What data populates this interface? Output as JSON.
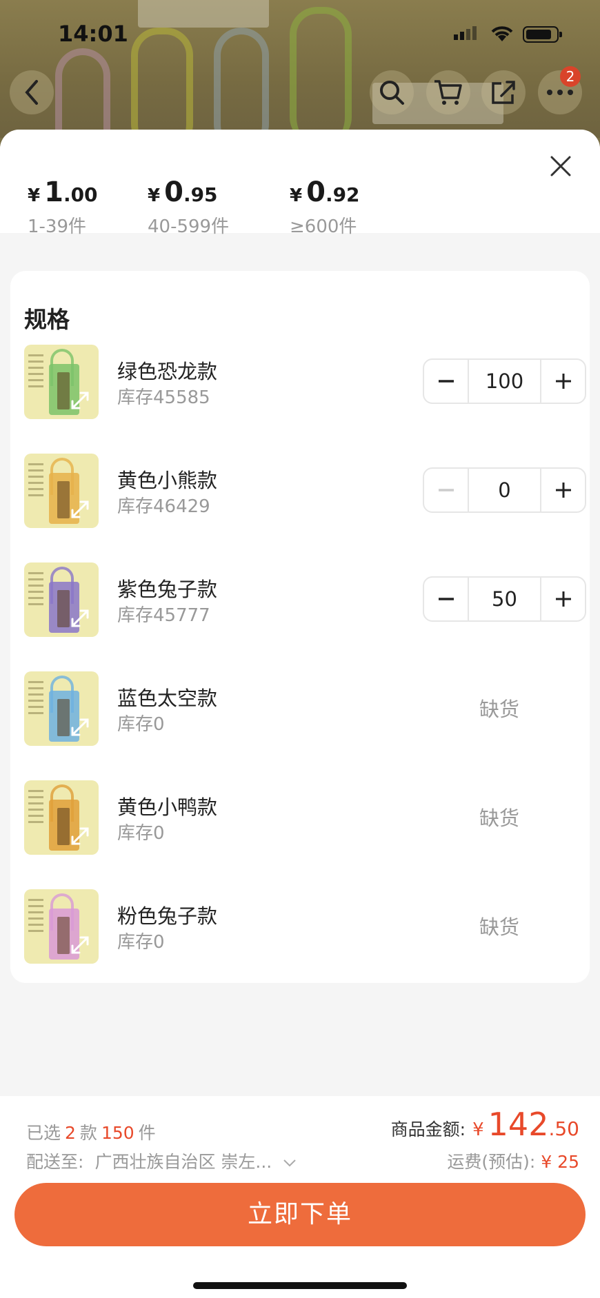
{
  "status": {
    "time": "14:01"
  },
  "nav": {
    "cart_badge": "2"
  },
  "price_tiers": [
    {
      "currency": "¥",
      "int": "1",
      "dec": ".00",
      "range": "1-39件"
    },
    {
      "currency": "¥",
      "int": "0",
      "dec": ".95",
      "range": "40-599件"
    },
    {
      "currency": "¥",
      "int": "0",
      "dec": ".92",
      "range": "≥600件"
    }
  ],
  "spec": {
    "title": "规格",
    "items": [
      {
        "name": "绿色恐龙款",
        "stock": "库存45585",
        "qty": "100",
        "color": "#7cc36a"
      },
      {
        "name": "黄色小熊款",
        "stock": "库存46429",
        "qty": "0",
        "color": "#e6b24a"
      },
      {
        "name": "紫色兔子款",
        "stock": "库存45777",
        "qty": "50",
        "color": "#8a77c9"
      },
      {
        "name": "蓝色太空款",
        "stock": "库存0",
        "status": "缺货",
        "color": "#6fb2e0"
      },
      {
        "name": "黄色小鸭款",
        "stock": "库存0",
        "status": "缺货",
        "color": "#e0a03a"
      },
      {
        "name": "粉色兔子款",
        "stock": "库存0",
        "status": "缺货",
        "color": "#d99ad6"
      }
    ]
  },
  "summary": {
    "selected_prefix": "已选",
    "selected_styles": "2",
    "styles_unit": "款",
    "selected_pieces": "150",
    "pieces_unit": "件",
    "ship_label": "配送至:",
    "ship_dest": "广西壮族自治区 崇左...",
    "amount_label": "商品金额:",
    "amount_currency": "¥",
    "amount_int": "142",
    "amount_dec": ".50",
    "freight_label": "运费(预估):",
    "freight_value": "¥ 25"
  },
  "order_button": "立即下单",
  "colors": {
    "accent": "#ee6c3c",
    "price_red": "#e8492a"
  }
}
